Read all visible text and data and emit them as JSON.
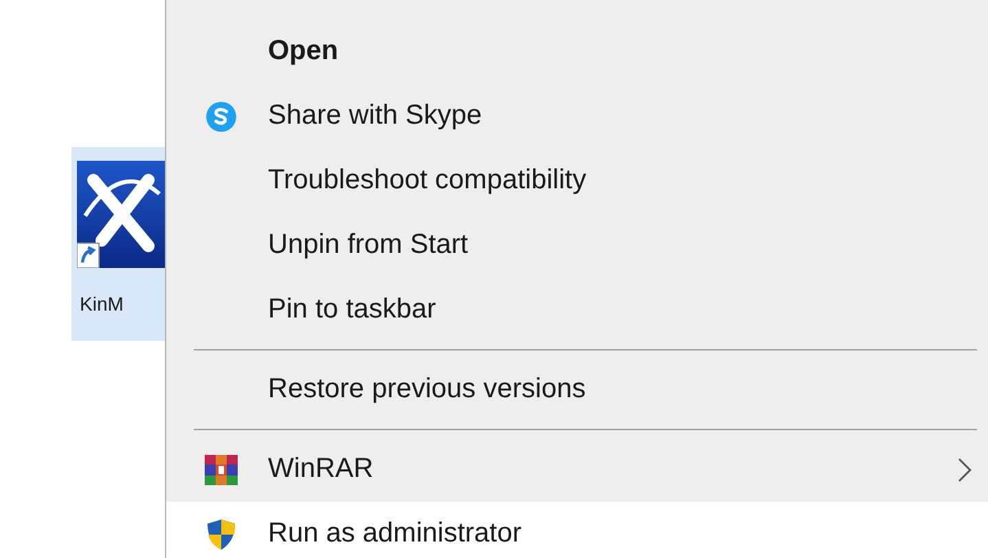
{
  "desktop_icon": {
    "label": "KinM",
    "selected": true
  },
  "context_menu": [
    {
      "kind": "item",
      "label": "Open",
      "bold": true,
      "selected": false
    },
    {
      "kind": "share",
      "label": "Share with Skype",
      "selected": false
    },
    {
      "kind": "item",
      "label": "Troubleshoot compatibility",
      "selected": false
    },
    {
      "kind": "item",
      "label": "Unpin from Start",
      "selected": false
    },
    {
      "kind": "item",
      "label": "Pin to taskbar",
      "selected": false
    },
    {
      "kind": "separator"
    },
    {
      "kind": "item",
      "label": "Restore previous versions",
      "selected": false
    },
    {
      "kind": "separator"
    },
    {
      "kind": "archive",
      "label": "WinRAR",
      "submenu": true,
      "selected": false
    },
    {
      "kind": "elevated",
      "label": "Run as administrator",
      "selected": true
    }
  ]
}
